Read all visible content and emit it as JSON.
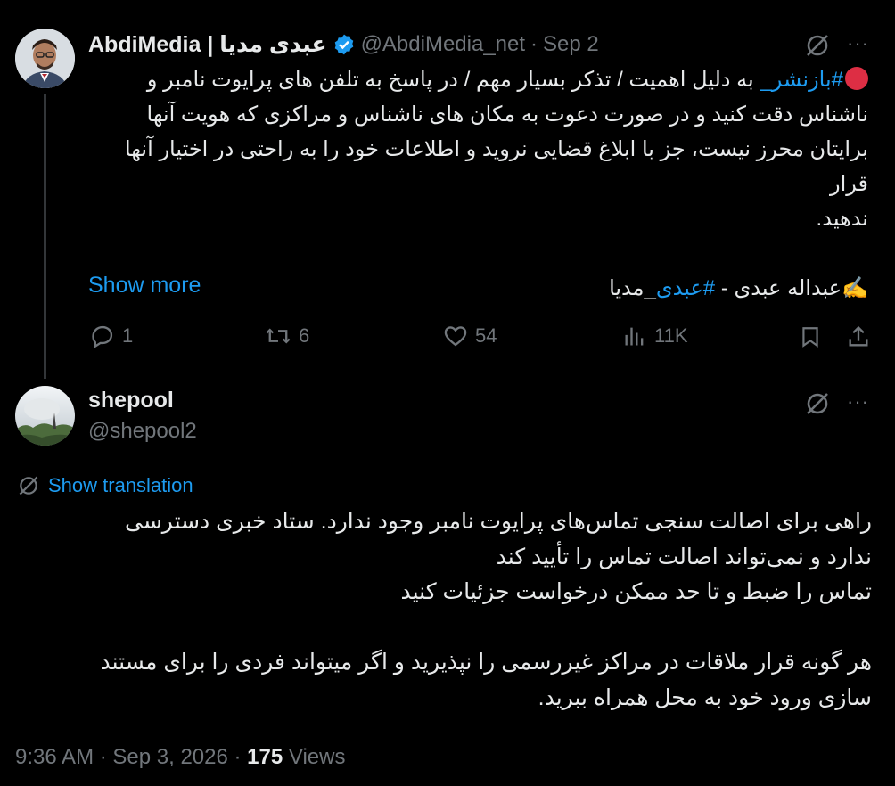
{
  "tweet": {
    "display_name": "AbdiMedia | عبدی مدیا",
    "handle": "@AbdiMedia_net",
    "separator": "·",
    "date": "Sep 2",
    "lines": {
      "hashtag1": "#بازنشر_",
      "line1_rest": " به دلیل اهمیت / تذکر بسیار مهم / در پاسخ به تلفن های پرایوت نامبر و",
      "line2": "ناشناس دقت کنید و در صورت دعوت به مکان های ناشناس و مراکزی که هویت آنها",
      "line3": "برایتان محرز نیست، جز با ابلاغ قضایی نروید و اطلاعات خود را به راحتی در اختیار آنها قرار",
      "line4": "ندهید.",
      "sign_prefix": "✍️عبداله عبدی - ",
      "hashtag2": "#عبدی",
      "sign_suffix": "_مدیا"
    },
    "show_more": "Show more",
    "stats": {
      "replies": "1",
      "reposts": "6",
      "likes": "54",
      "views": "11K"
    },
    "more_label": "···"
  },
  "reply": {
    "display_name": "shepool",
    "handle": "@shepool2",
    "more_label": "···",
    "show_translation": "Show translation",
    "lines": [
      "راهی برای اصالت سنجی تماس‌های پرایوت نامبر وجود ندارد. ستاد خبری دسترسی",
      "ندارد و نمی‌تواند اصالت تماس را تأیید کند",
      "تماس را ضبط و تا حد ممکن درخواست جزئیات کنید",
      "",
      "هر گونه قرار ملاقات در مراکز غیررسمی را نپذیرید و اگر میتواند فردی را برای مستند",
      "سازی ورود خود به محل همراه ببرید."
    ],
    "timestamp": "9:36 AM · Sep 3, 2026 · ",
    "views_count": "175",
    "views_label": " Views"
  },
  "colors": {
    "background": "#000000",
    "text": "#e7e9ea",
    "muted": "#71767b",
    "accent": "#1d9bf0",
    "verified": "#1d9bf0",
    "red_circle": "#dd2e44"
  },
  "icons": [
    "grok-icon",
    "more-icon",
    "reply-icon",
    "repost-icon",
    "like-icon",
    "views-icon",
    "bookmark-icon",
    "share-icon",
    "verified-badge-icon",
    "translate-icon",
    "red-circle-emoji"
  ]
}
